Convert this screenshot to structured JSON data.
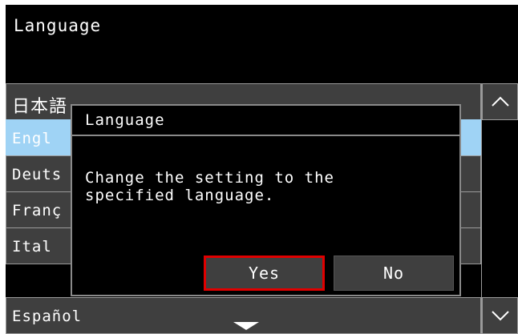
{
  "header": {
    "title": "Language"
  },
  "language_list": {
    "items": [
      {
        "label": "日本語",
        "selected": false
      },
      {
        "label": "Engl",
        "selected": true
      },
      {
        "label": "Deuts",
        "selected": false
      },
      {
        "label": "Franç",
        "selected": false
      },
      {
        "label": "Ital",
        "selected": false
      },
      {
        "label": "Español",
        "selected": false
      }
    ]
  },
  "scrollbar": {
    "up_icon": "chevron-up-icon",
    "down_icon": "chevron-down-icon"
  },
  "more_indicator": {
    "icon": "triangle-down-icon"
  },
  "dialog": {
    "title": "Language",
    "message": "Change the setting to the\nspecified language.",
    "yes_label": "Yes",
    "no_label": "No"
  },
  "colors": {
    "background": "#000000",
    "item_fill": "#3f3f3f",
    "item_border": "#9a9a9a",
    "selected_fill": "#9fd3f5",
    "focus_border": "#e00000"
  }
}
